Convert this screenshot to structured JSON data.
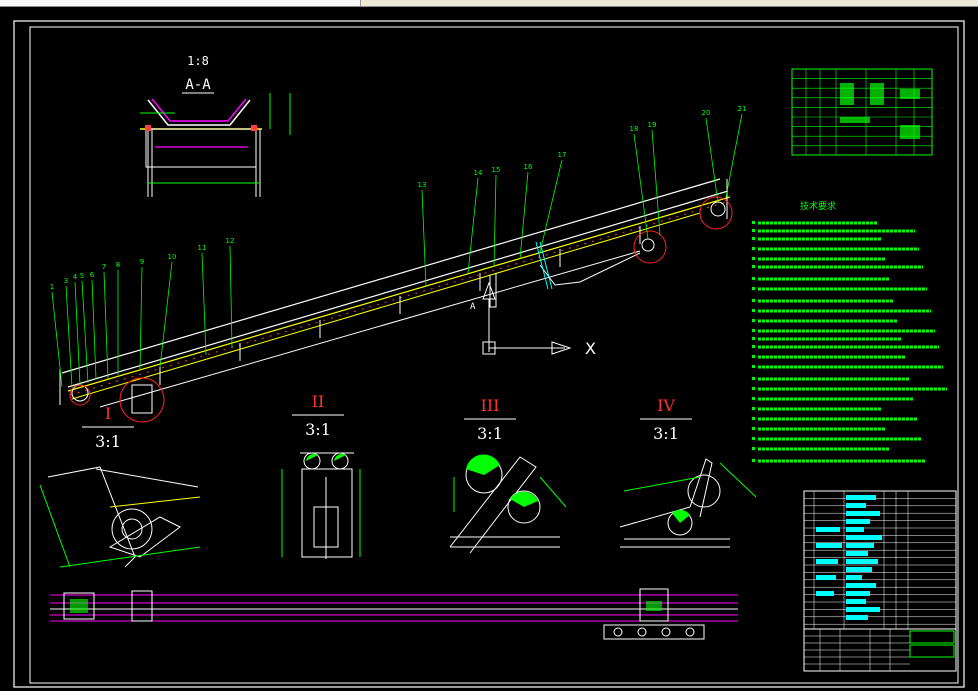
{
  "colors": {
    "background": "#000000",
    "border": "#ffffff",
    "belt": "#ffffff",
    "structure": "#ffff00",
    "centerline": "#ff4040",
    "leader": "#00ff00",
    "dimension": "#00ff00",
    "idler": "#ff00ff",
    "table_fill": "#00ffff"
  },
  "section_view": {
    "scale": "1:8",
    "label": "A-A"
  },
  "balloons": [
    "1",
    "3",
    "4",
    "5",
    "6",
    "7",
    "8",
    "9",
    "10",
    "11",
    "12",
    "13",
    "14",
    "15",
    "16",
    "17",
    "18",
    "19",
    "20",
    "21"
  ],
  "ucs": {
    "x_label": "X"
  },
  "section_label_main": "A",
  "details": [
    {
      "id": "I",
      "scale": "3:1"
    },
    {
      "id": "II",
      "scale": "3:1"
    },
    {
      "id": "III",
      "scale": "3:1"
    },
    {
      "id": "IV",
      "scale": "3:1"
    }
  ],
  "tech_notes": {
    "heading": "技术要求"
  }
}
